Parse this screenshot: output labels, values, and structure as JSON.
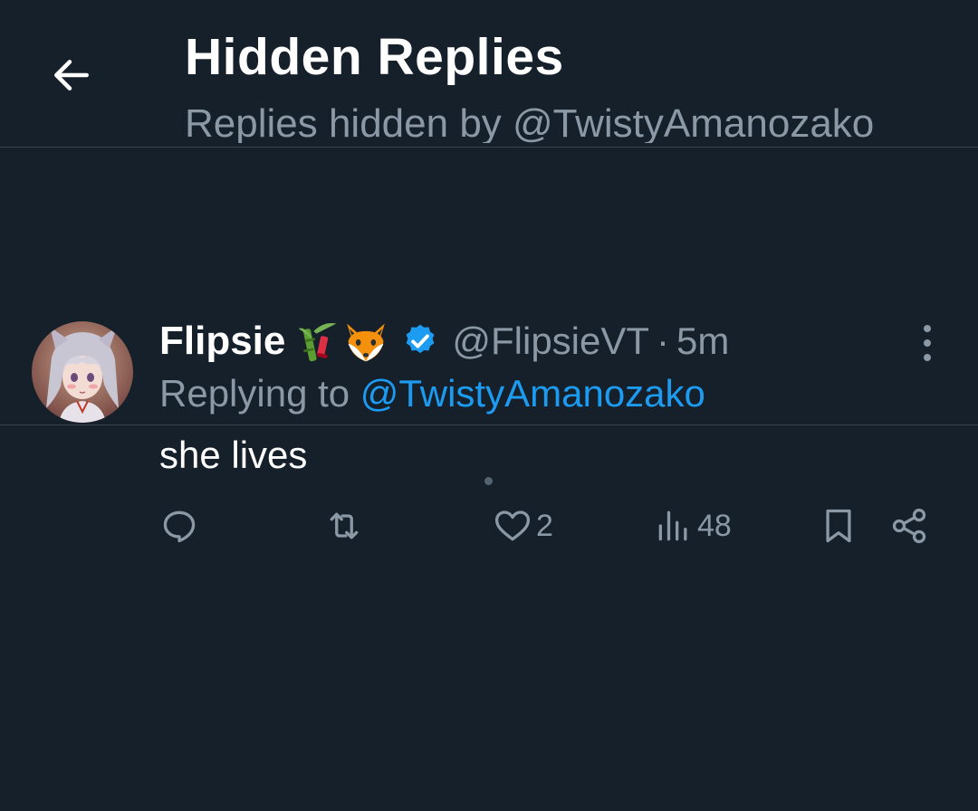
{
  "header": {
    "title": "Hidden Replies",
    "subtitle": "Replies hidden by @TwistyAmanozako",
    "back_icon": "arrow-left-icon"
  },
  "tweet": {
    "display_name": "Flipsie",
    "name_emojis": [
      "bamboo-emoji",
      "fox-emoji"
    ],
    "verified_icon": "verified-badge-icon",
    "handle": "@FlipsieVT",
    "separator": "·",
    "time": "5m",
    "replying_prefix": "Replying to",
    "replying_to": "@TwistyAmanozako",
    "text": "she lives",
    "actions": {
      "reply": {
        "icon": "reply-icon",
        "count": ""
      },
      "retweet": {
        "icon": "retweet-icon",
        "count": ""
      },
      "like": {
        "icon": "heart-icon",
        "count": "2"
      },
      "views": {
        "icon": "views-icon",
        "count": "48"
      },
      "bookmark": {
        "icon": "bookmark-icon"
      },
      "share": {
        "icon": "share-icon"
      }
    }
  },
  "colors": {
    "background": "#15202b",
    "divider": "#38444d",
    "secondary_text": "#8b98a5",
    "accent": "#1d9bf0"
  }
}
